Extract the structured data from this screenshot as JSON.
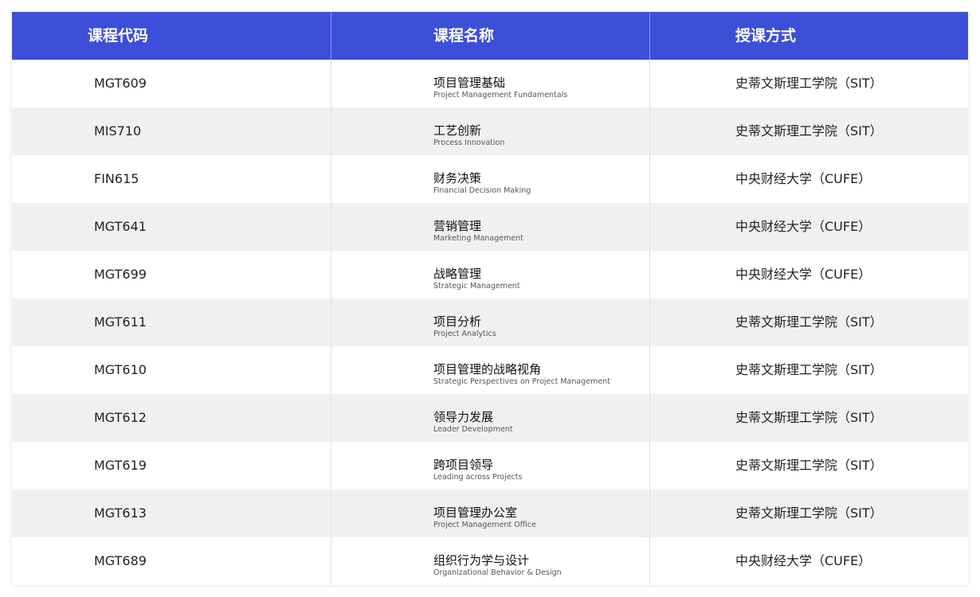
{
  "table": {
    "headers": [
      "课程代码",
      "课程名称",
      "授课方式"
    ],
    "rows": [
      {
        "code": "MGT609",
        "name_zh": "项目管理基础",
        "name_en": "Project Management Fundamentals",
        "method": "史蒂文斯理工学院（SIT）"
      },
      {
        "code": "MIS710",
        "name_zh": "工艺创新",
        "name_en": "Process Innovation",
        "method": "史蒂文斯理工学院（SIT）"
      },
      {
        "code": "FIN615",
        "name_zh": "财务决策",
        "name_en": "Financial Decision Making",
        "method": "中央财经大学（CUFE）"
      },
      {
        "code": "MGT641",
        "name_zh": "营销管理",
        "name_en": "Marketing Management",
        "method": "中央财经大学（CUFE）"
      },
      {
        "code": "MGT699",
        "name_zh": "战略管理",
        "name_en": "Strategic Management",
        "method": "中央财经大学（CUFE）"
      },
      {
        "code": "MGT611",
        "name_zh": "项目分析",
        "name_en": "Project Analytics",
        "method": "史蒂文斯理工学院（SIT）"
      },
      {
        "code": "MGT610",
        "name_zh": "项目管理的战略视角",
        "name_en": "Strategic Perspectives on Project Management",
        "method": "史蒂文斯理工学院（SIT）"
      },
      {
        "code": "MGT612",
        "name_zh": "领导力发展",
        "name_en": "Leader Development",
        "method": "史蒂文斯理工学院（SIT）"
      },
      {
        "code": "MGT619",
        "name_zh": "跨项目领导",
        "name_en": "Leading across Projects",
        "method": "史蒂文斯理工学院（SIT）"
      },
      {
        "code": "MGT613",
        "name_zh": "项目管理办公室",
        "name_en": "Project Management Office",
        "method": "史蒂文斯理工学院（SIT）"
      },
      {
        "code": "MGT689",
        "name_zh": "组织行为学与设计",
        "name_en": "Organizational Behavior & Design",
        "method": "中央财经大学（CUFE）"
      }
    ]
  },
  "colors": {
    "header_bg": "#3d4ed8",
    "alt_row_bg": "#f0f0f0"
  }
}
